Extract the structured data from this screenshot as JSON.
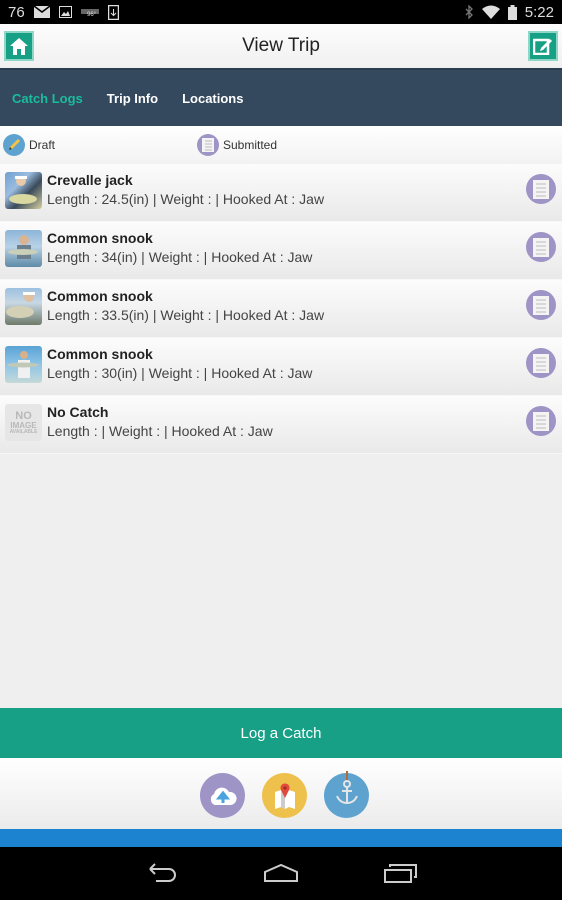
{
  "status_bar": {
    "left_number": "76",
    "icons_left": [
      "mail-icon",
      "image-icon",
      "weather-icon",
      "download-icon"
    ],
    "icons_right": [
      "bluetooth-icon",
      "wifi-icon",
      "battery-icon"
    ],
    "time": "5:22"
  },
  "header": {
    "title": "View Trip",
    "home_icon": "home-icon",
    "edit_icon": "edit-icon"
  },
  "tabs": [
    {
      "label": "Catch Logs",
      "active": true
    },
    {
      "label": "Trip Info",
      "active": false
    },
    {
      "label": "Locations",
      "active": false
    }
  ],
  "legend": {
    "draft_label": "Draft",
    "submitted_label": "Submitted"
  },
  "catches": [
    {
      "species": "Crevalle jack",
      "details": "Length : 24.5(in) | Weight : | Hooked At : Jaw",
      "photo": "angler-photo",
      "status": "submitted"
    },
    {
      "species": "Common snook",
      "details": "Length : 34(in) | Weight : | Hooked At : Jaw",
      "photo": "angler-photo",
      "status": "submitted"
    },
    {
      "species": "Common snook",
      "details": "Length : 33.5(in) | Weight : | Hooked At : Jaw",
      "photo": "angler-photo",
      "status": "submitted"
    },
    {
      "species": "Common snook",
      "details": "Length : 30(in) | Weight : | Hooked At : Jaw",
      "photo": "angler-photo",
      "status": "submitted"
    },
    {
      "species": "No Catch",
      "details": "Length : | Weight : | Hooked At : Jaw",
      "photo": "no-image",
      "status": "submitted",
      "no_image_text": [
        "NO",
        "IMAGE",
        "AVAILABLE"
      ]
    }
  ],
  "log_button": "Log a Catch",
  "footer_icons": [
    "cloud-upload-icon",
    "map-icon",
    "anchor-icon"
  ],
  "colors": {
    "accent": "#17a086",
    "tabbar": "#34495e",
    "active_tab": "#1abc9c",
    "submitted": "#9e94c6",
    "draft": "#5ea3cf",
    "map": "#eec04c",
    "anchor": "#5ea3cf"
  }
}
